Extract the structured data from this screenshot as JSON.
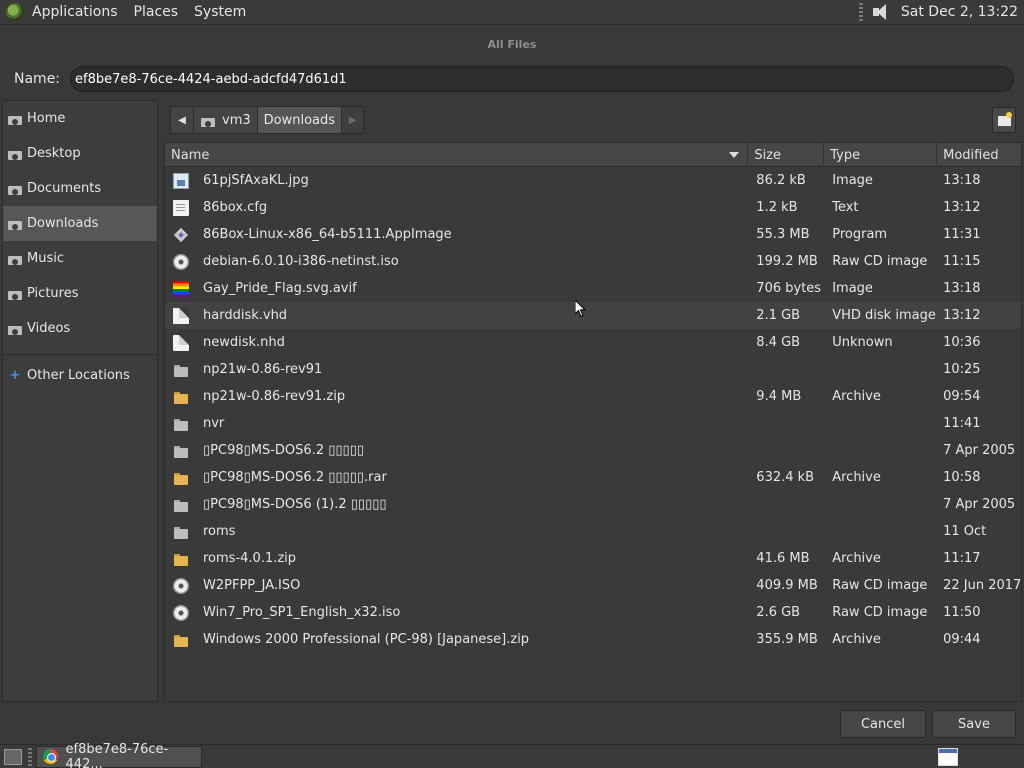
{
  "top_panel": {
    "menus": [
      "Applications",
      "Places",
      "System"
    ],
    "clock": "Sat Dec  2, 13:22"
  },
  "dialog": {
    "title": "All Files",
    "name_label": "Name:",
    "name_value": "ef8be7e8-76ce-4424-aebd-adcfd47d61d1",
    "sidebar": {
      "items": [
        {
          "label": "Home"
        },
        {
          "label": "Desktop"
        },
        {
          "label": "Documents"
        },
        {
          "label": "Downloads"
        },
        {
          "label": "Music"
        },
        {
          "label": "Pictures"
        },
        {
          "label": "Videos"
        }
      ],
      "other_locations": "Other Locations"
    },
    "pathbar": {
      "segments": [
        "vm3",
        "Downloads"
      ]
    },
    "columns": {
      "name": "Name",
      "size": "Size",
      "type": "Type",
      "modified": "Modified"
    },
    "files": [
      {
        "name": "61pjSfAxaKL.jpg",
        "size": "86.2 kB",
        "type": "Image",
        "modified": "13:18",
        "icon": "image-icon"
      },
      {
        "name": "86box.cfg",
        "size": "1.2 kB",
        "type": "Text",
        "modified": "13:12",
        "icon": "text-file-icon"
      },
      {
        "name": "86Box-Linux-x86_64-b5111.AppImage",
        "size": "55.3 MB",
        "type": "Program",
        "modified": "11:31",
        "icon": "program-icon"
      },
      {
        "name": "debian-6.0.10-i386-netinst.iso",
        "size": "199.2 MB",
        "type": "Raw CD image",
        "modified": "11:15",
        "icon": "disc-icon"
      },
      {
        "name": "Gay_Pride_Flag.svg.avif",
        "size": "706 bytes",
        "type": "Image",
        "modified": "13:18",
        "icon": "flag-image-icon"
      },
      {
        "name": "harddisk.vhd",
        "size": "2.1 GB",
        "type": "VHD disk image",
        "modified": "13:12",
        "icon": "file-icon"
      },
      {
        "name": "newdisk.nhd",
        "size": "8.4 GB",
        "type": "Unknown",
        "modified": "10:36",
        "icon": "file-icon"
      },
      {
        "name": "np21w-0.86-rev91",
        "size": "",
        "type": "",
        "modified": "10:25",
        "icon": "folder-icon"
      },
      {
        "name": "np21w-0.86-rev91.zip",
        "size": "9.4 MB",
        "type": "Archive",
        "modified": "09:54",
        "icon": "archive-icon"
      },
      {
        "name": "nvr",
        "size": "",
        "type": "",
        "modified": "11:41",
        "icon": "folder-icon"
      },
      {
        "name": "▯PC98▯MS-DOS6.2  ▯▯▯▯▯",
        "size": "",
        "type": "",
        "modified": "7 Apr 2005",
        "icon": "folder-icon"
      },
      {
        "name": "▯PC98▯MS-DOS6.2  ▯▯▯▯▯.rar",
        "size": "632.4 kB",
        "type": "Archive",
        "modified": "10:58",
        "icon": "archive-icon"
      },
      {
        "name": "▯PC98▯MS-DOS6 (1).2  ▯▯▯▯▯",
        "size": "",
        "type": "",
        "modified": "7 Apr 2005",
        "icon": "folder-icon"
      },
      {
        "name": "roms",
        "size": "",
        "type": "",
        "modified": "11 Oct",
        "icon": "folder-icon"
      },
      {
        "name": "roms-4.0.1.zip",
        "size": "41.6 MB",
        "type": "Archive",
        "modified": "11:17",
        "icon": "archive-icon"
      },
      {
        "name": "W2PFPP_JA.ISO",
        "size": "409.9 MB",
        "type": "Raw CD image",
        "modified": "22 Jun 2017",
        "icon": "disc-icon"
      },
      {
        "name": "Win7_Pro_SP1_English_x32.iso",
        "size": "2.6 GB",
        "type": "Raw CD image",
        "modified": "11:50",
        "icon": "disc-icon"
      },
      {
        "name": "Windows 2000 Professional (PC-98) [Japanese].zip",
        "size": "355.9 MB",
        "type": "Archive",
        "modified": "09:44",
        "icon": "archive-icon"
      }
    ],
    "buttons": {
      "cancel": "Cancel",
      "save": "Save"
    }
  },
  "taskbar": {
    "task_label": "ef8be7e8-76ce-442..."
  }
}
